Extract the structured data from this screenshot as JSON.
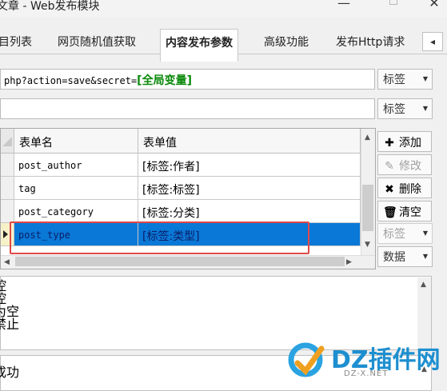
{
  "window": {
    "title": "文章 - Web发布模块",
    "min": "—",
    "max": "☐",
    "close": "✕"
  },
  "tabs": [
    {
      "label": "目列表"
    },
    {
      "label": "网页随机值获取"
    },
    {
      "label": "内容发布参数",
      "active": true
    },
    {
      "label": "高级功能"
    },
    {
      "label": "发布Http请求"
    }
  ],
  "tab_nav": "◂",
  "url": {
    "prefix": "php?action=save&secret=",
    "variable": "[全局变量]"
  },
  "label_dropdown": "标签",
  "grid": {
    "headers": [
      "表单名",
      "表单值"
    ],
    "rows": [
      {
        "name": "post_author",
        "value": "[标签:作者]",
        "selected": false
      },
      {
        "name": "tag",
        "value": "[标签:标签]",
        "selected": false
      },
      {
        "name": "post_category",
        "value": "[标签:分类]",
        "selected": false
      },
      {
        "name": "post_type",
        "value": "[标签:类型]",
        "selected": true
      }
    ]
  },
  "side_buttons": {
    "add": "添加",
    "edit": "修改",
    "delete": "删除",
    "clear": "清空",
    "label": "标签",
    "data": "数据"
  },
  "text_box_1_lines": [
    "控",
    "控",
    "为空",
    "禁止"
  ],
  "text_box_2_line": "成功",
  "watermark": {
    "text": "DZ插件网",
    "url": "DZ-X.NET"
  }
}
